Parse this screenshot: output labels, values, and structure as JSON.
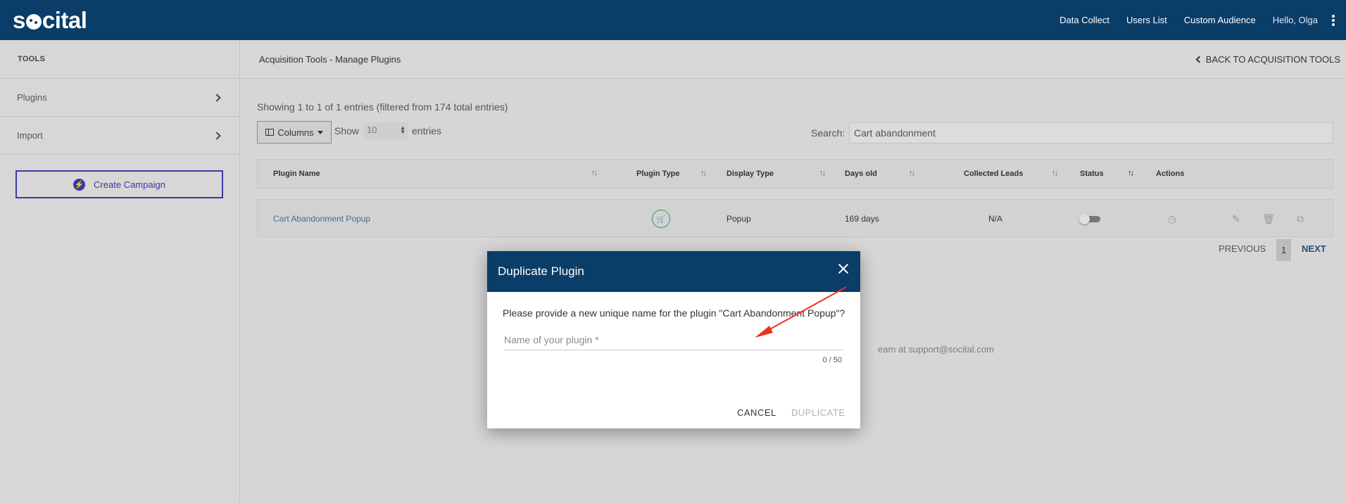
{
  "topbar": {
    "logo": {
      "left": "s",
      "right": "cital"
    },
    "nav": [
      "Data Collect",
      "Users List",
      "Custom Audience"
    ],
    "greeting": "Hello, Olga"
  },
  "sidebar": {
    "title": "TOOLS",
    "items": [
      {
        "label": "Plugins"
      },
      {
        "label": "Import"
      }
    ],
    "create_button": "Create Campaign"
  },
  "subheader": {
    "breadcrumb": "Acquisition Tools - Manage Plugins",
    "back_label": "BACK TO ACQUISITION TOOLS"
  },
  "table": {
    "info": "Showing 1 to 1 of 1 entries (filtered from 174 total entries)",
    "columns_button": "Columns",
    "show_label": "Show",
    "page_size": "10",
    "entries_label": "entries",
    "search_label": "Search:",
    "search_value": "Cart abandonment",
    "headers": [
      "Plugin Name",
      "Plugin Type",
      "Display Type",
      "Days old",
      "Collected Leads",
      "Status",
      "Actions"
    ],
    "rows": [
      {
        "name": "Cart Abandonment Popup",
        "display_type": "Popup",
        "days_old": "169 days",
        "leads": "N/A",
        "status_on": false
      }
    ]
  },
  "pagination": {
    "previous": "PREVIOUS",
    "current": "1",
    "next": "NEXT"
  },
  "footer": {
    "text": "eam at support@socital.com"
  },
  "modal": {
    "title": "Duplicate Plugin",
    "message": "Please provide a new unique name for the plugin \"Cart Abandonment Popup\"?",
    "input_placeholder": "Name of your plugin *",
    "counter": "0 / 50",
    "cancel": "CANCEL",
    "duplicate": "DUPLICATE"
  },
  "colors": {
    "brand": "#0a3d68",
    "accent": "#3a3aa6",
    "success": "#3c9a4c",
    "annotation": "#e8321e"
  }
}
